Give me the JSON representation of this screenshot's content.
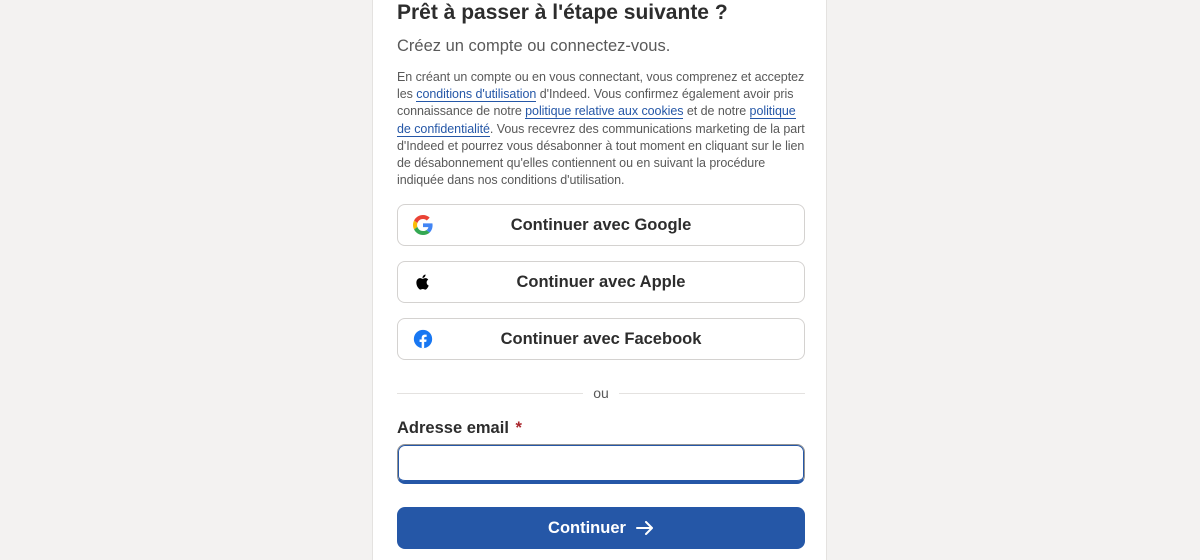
{
  "heading": "Prêt à passer à l'étape suivante ?",
  "subheading": "Créez un compte ou connectez-vous.",
  "legal": {
    "part1": "En créant un compte ou en vous connectant, vous comprenez et acceptez les ",
    "terms_link": "conditions d'utilisation",
    "part2": " d'Indeed. Vous confirmez également avoir pris connaissance de notre ",
    "cookies_link": "politique relative aux cookies",
    "part3": " et de notre ",
    "privacy_link": "politique de confidentialité",
    "part4": ". Vous recevrez des communications marketing de la part d'Indeed et pourrez vous désabonner à tout moment en cliquant sur le lien de désabonnement qu'elles contiennent ou en suivant la procédure indiquée dans nos conditions d'utilisation."
  },
  "sso": {
    "google_label": "Continuer avec Google",
    "apple_label": "Continuer avec Apple",
    "facebook_label": "Continuer avec Facebook"
  },
  "divider_text": "ou",
  "email": {
    "label": "Adresse email",
    "required_mark": "*",
    "value": ""
  },
  "continue_label": "Continuer",
  "colors": {
    "accent": "#2557a7",
    "required": "#a9252b",
    "facebook": "#1877f2"
  },
  "icons": [
    "google-icon",
    "apple-icon",
    "facebook-icon",
    "arrow-right-icon"
  ]
}
